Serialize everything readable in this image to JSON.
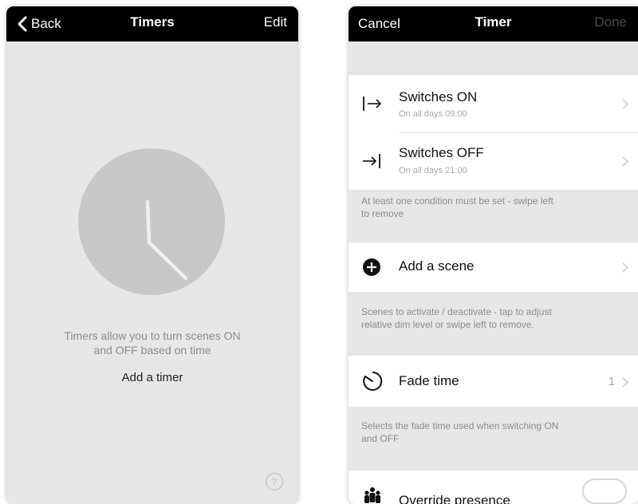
{
  "left_screen": {
    "nav": {
      "back_label": "Back",
      "title": "Timers",
      "edit_label": "Edit"
    },
    "empty_message_line1": "Timers allow you to turn scenes ON",
    "empty_message_line2": "and OFF based on time",
    "add_timer_label": "Add a timer",
    "help_symbol": "?"
  },
  "right_screen": {
    "nav": {
      "cancel_label": "Cancel",
      "title": "Timer",
      "done_label": "Done"
    },
    "conditions": [
      {
        "title": "Switches ON",
        "subtitle": "On all days  09:00",
        "icon": "arrow-to-bar-icon"
      },
      {
        "title": "Switches OFF",
        "subtitle": "On all days  21:00",
        "icon": "arrow-into-bar-icon"
      }
    ],
    "conditions_note_line1": "At least one condition must be set - swipe left",
    "conditions_note_line2": "to remove",
    "add_scene_label": "Add a scene",
    "scenes_note_line1": "Scenes to activate / deactivate - tap to adjust",
    "scenes_note_line2": "relative dim level or swipe left to remove.",
    "fade_time_label": "Fade time",
    "fade_time_value": "1",
    "fade_note_line1": "Selects the fade time used when switching ON",
    "fade_note_line2": "and OFF",
    "override_presence_label": "Override presence"
  },
  "colors": {
    "navbar": "#000000",
    "background": "#e6e6e6",
    "cell": "#ffffff",
    "muted_text": "#8e8e8e",
    "clock": "#c8c8c8"
  }
}
